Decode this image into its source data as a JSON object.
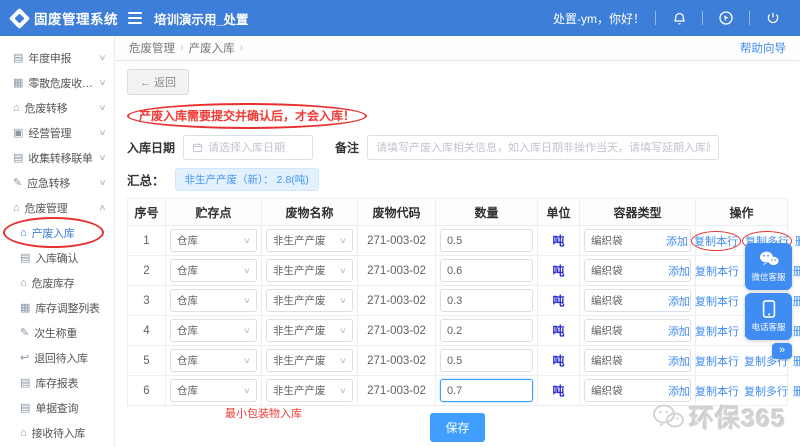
{
  "header": {
    "brand": "固废管理系统",
    "page_title": "培训演示用_处置",
    "greeting": "处置-ym，你好！"
  },
  "sidebar": {
    "items": [
      {
        "icon": "▤",
        "icon_name": "report-icon",
        "label": "年度申报",
        "chevron": "∨"
      },
      {
        "icon": "▦",
        "icon_name": "form-icon",
        "label": "零散危废收集填报",
        "chevron": "∨"
      },
      {
        "icon": "⌂",
        "icon_name": "transfer-icon",
        "label": "危废转移",
        "chevron": "∨"
      },
      {
        "icon": "▣",
        "icon_name": "manage-icon",
        "label": "经营管理",
        "chevron": "∨"
      },
      {
        "icon": "▤",
        "icon_name": "manifest-icon",
        "label": "收集转移联单",
        "chevron": "∨"
      },
      {
        "icon": "✎",
        "icon_name": "emergency-icon",
        "label": "应急转移",
        "chevron": "∨"
      },
      {
        "icon": "⌂",
        "icon_name": "hazard-icon",
        "label": "危废管理",
        "chevron": "∧"
      },
      {
        "icon": "⌂",
        "icon_name": "inbound-icon",
        "label": "产废入库",
        "sub": true,
        "active": true,
        "circled": true
      },
      {
        "icon": "▤",
        "icon_name": "confirm-icon",
        "label": "入库确认",
        "sub": true
      },
      {
        "icon": "⌂",
        "icon_name": "stock-icon",
        "label": "危废库存",
        "sub": true
      },
      {
        "icon": "▦",
        "icon_name": "adjust-icon",
        "label": "库存调整列表",
        "sub": true
      },
      {
        "icon": "✎",
        "icon_name": "weigh-icon",
        "label": "次生称重",
        "sub": true
      },
      {
        "icon": "↩",
        "icon_name": "return-icon",
        "label": "退回待入库",
        "sub": true
      },
      {
        "icon": "▤",
        "icon_name": "report2-icon",
        "label": "库存报表",
        "sub": true
      },
      {
        "icon": "▤",
        "icon_name": "query-icon",
        "label": "单据查询",
        "sub": true
      },
      {
        "icon": "⌂",
        "icon_name": "receive-icon",
        "label": "接收待入库",
        "sub": true
      }
    ]
  },
  "breadcrumb": {
    "crumbs": [
      "危废管理",
      "产废入库"
    ],
    "separator": "›",
    "help": "帮助向导"
  },
  "toolbar": {
    "back_label": "← 返回"
  },
  "notice": "产废入库需要提交并确认后，才会入库！",
  "form": {
    "date_label": "入库日期",
    "date_placeholder": "请选择入库日期",
    "remark_label": "备注",
    "remark_placeholder": "请填写产废入库相关信息，如入库日期非操作当天，请填写延期入库原因"
  },
  "summary": {
    "label": "汇总：",
    "badge": "非生产产废（新）： 2.8(吨)"
  },
  "table": {
    "headers": [
      "序号",
      "贮存点",
      "废物名称",
      "废物代码",
      "数量",
      "单位",
      "容器类型",
      "操作"
    ],
    "action_labels": [
      "添加",
      "复制本行",
      "复制多行",
      "删除"
    ],
    "rows": [
      {
        "seq": "1",
        "storage": "仓库",
        "name": "非生产产废",
        "code": "271-003-02",
        "qty": "0.5",
        "unit": "吨",
        "container": "编织袋",
        "circled": true
      },
      {
        "seq": "2",
        "storage": "仓库",
        "name": "非生产产废",
        "code": "271-003-02",
        "qty": "0.6",
        "unit": "吨",
        "container": "编织袋"
      },
      {
        "seq": "3",
        "storage": "仓库",
        "name": "非生产产废",
        "code": "271-003-02",
        "qty": "0.3",
        "unit": "吨",
        "container": "编织袋"
      },
      {
        "seq": "4",
        "storage": "仓库",
        "name": "非生产产废",
        "code": "271-003-02",
        "qty": "0.2",
        "unit": "吨",
        "container": "编织袋"
      },
      {
        "seq": "5",
        "storage": "仓库",
        "name": "非生产产废",
        "code": "271-003-02",
        "qty": "0.5",
        "unit": "吨",
        "container": "编织袋"
      },
      {
        "seq": "6",
        "storage": "仓库",
        "name": "非生产产废",
        "code": "271-003-02",
        "qty": "0.7",
        "unit": "吨",
        "container": "编织袋",
        "qty_focused": true
      }
    ]
  },
  "save_label": "保存",
  "annotations": {
    "min_pack": "最小包装物入库"
  },
  "floating": {
    "wechat_label": "微信客服",
    "phone_label": "电话客服",
    "expand": "»"
  },
  "watermark": "环保365",
  "ui": {
    "chevron": "∨"
  },
  "colors": {
    "header_blue": "#3d7ed9",
    "link_blue": "#3f8cf3",
    "accent_blue": "#409eff",
    "annotation_red": "#e8312e",
    "unit_blue": "#2b2bd0"
  }
}
